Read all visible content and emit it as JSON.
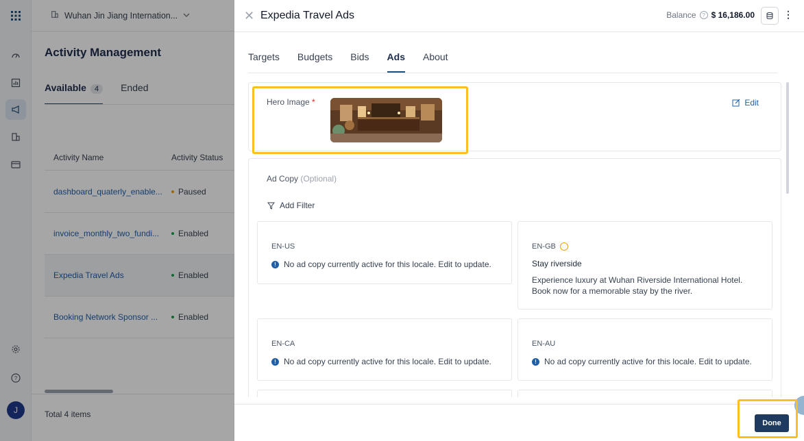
{
  "sidebar": {
    "avatar_initial": "J",
    "icons": [
      "apps-grid-icon",
      "dashboard-icon",
      "report-icon",
      "megaphone-icon",
      "building-icon",
      "billing-icon",
      "settings-icon",
      "help-icon"
    ]
  },
  "topbar": {
    "property": "Wuhan Jin Jiang Internation..."
  },
  "background_page": {
    "title": "Activity Management",
    "tabs": [
      {
        "label": "Available",
        "count": "4"
      },
      {
        "label": "Ended"
      }
    ],
    "columns": [
      "Activity Name",
      "Activity Status"
    ],
    "rows": [
      {
        "name": "dashboard_quaterly_enable...",
        "status": "Paused",
        "status_color": "#f59e0b"
      },
      {
        "name": "invoice_monthly_two_fundi...",
        "status": "Enabled",
        "status_color": "#16a34a"
      },
      {
        "name": "Expedia Travel Ads",
        "status": "Enabled",
        "status_color": "#16a34a"
      },
      {
        "name": "Booking Network Sponsor ...",
        "status": "Enabled",
        "status_color": "#16a34a"
      }
    ],
    "footer": "Total 4 items"
  },
  "drawer": {
    "title": "Expedia Travel Ads",
    "balance_label": "Balance",
    "balance_value": "$ 16,186.00",
    "tabs": [
      "Targets",
      "Budgets",
      "Bids",
      "Ads",
      "About"
    ],
    "active_tab": "Ads",
    "hero": {
      "label": "Hero Image",
      "required_mark": "*",
      "edit_label": "Edit"
    },
    "ad_copy": {
      "label": "Ad Copy",
      "optional": "(Optional)",
      "filter_label": "Add Filter",
      "locales": [
        {
          "code": "EN-US",
          "message": "No ad copy currently active for this locale. Edit to update."
        },
        {
          "code": "EN-GB",
          "headline": "Stay riverside",
          "body": "Experience luxury at Wuhan Riverside International Hotel. Book now for a memorable stay by the river."
        },
        {
          "code": "EN-CA",
          "message": "No ad copy currently active for this locale. Edit to update."
        },
        {
          "code": "EN-AU",
          "message": "No ad copy currently active for this locale. Edit to update."
        }
      ]
    },
    "done_label": "Done"
  },
  "colors": {
    "accent": "#1f4e79",
    "highlight": "#fbbf24",
    "link": "#1f5fa8",
    "done_button": "#1e3a5f"
  }
}
